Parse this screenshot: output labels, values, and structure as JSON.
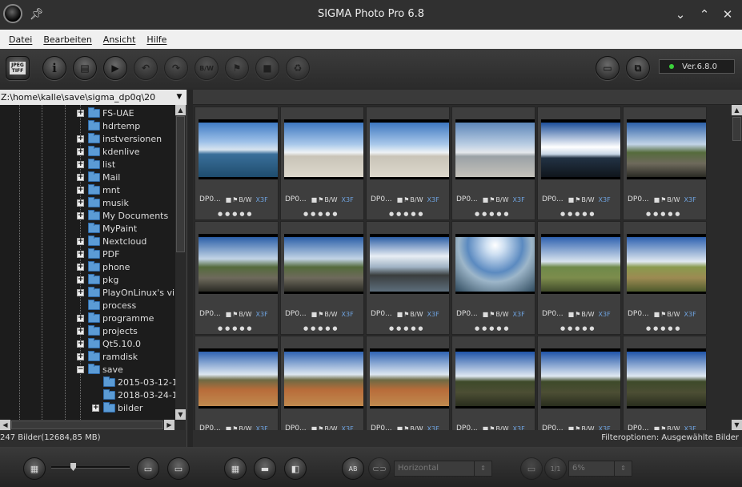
{
  "app": {
    "title": "SIGMA Photo Pro 6.8"
  },
  "window_controls": {
    "minimize": "⌄",
    "maximize": "⌃",
    "close": "✕"
  },
  "menu": [
    "Datei",
    "Bearbeiten",
    "Ansicht",
    "Hilfe"
  ],
  "toolbar": {
    "jpeg_tiff": "JPEG TIFF",
    "info": "i",
    "bw": "B/W",
    "version": "Ver.6.8.0"
  },
  "path": "Z:\\home\\kalle\\save\\sigma_dp0q\\20",
  "tree": [
    {
      "label": "FS-UAE",
      "expandable": true,
      "level": 1
    },
    {
      "label": "hdrtemp",
      "expandable": false,
      "level": 1
    },
    {
      "label": "instversionen",
      "expandable": true,
      "level": 1
    },
    {
      "label": "kdenlive",
      "expandable": true,
      "level": 1
    },
    {
      "label": "list",
      "expandable": true,
      "level": 1
    },
    {
      "label": "Mail",
      "expandable": true,
      "level": 1
    },
    {
      "label": "mnt",
      "expandable": true,
      "level": 1
    },
    {
      "label": "musik",
      "expandable": true,
      "level": 1
    },
    {
      "label": "My Documents",
      "expandable": true,
      "level": 1
    },
    {
      "label": "MyPaint",
      "expandable": false,
      "level": 1
    },
    {
      "label": "Nextcloud",
      "expandable": true,
      "level": 1
    },
    {
      "label": "PDF",
      "expandable": true,
      "level": 1
    },
    {
      "label": "phone",
      "expandable": true,
      "level": 1
    },
    {
      "label": "pkg",
      "expandable": true,
      "level": 1
    },
    {
      "label": "PlayOnLinux's virt",
      "expandable": true,
      "level": 1
    },
    {
      "label": "process",
      "expandable": false,
      "level": 1
    },
    {
      "label": "programme",
      "expandable": true,
      "level": 1
    },
    {
      "label": "projects",
      "expandable": true,
      "level": 1
    },
    {
      "label": "Qt5.10.0",
      "expandable": true,
      "level": 1
    },
    {
      "label": "ramdisk",
      "expandable": true,
      "level": 1
    },
    {
      "label": "save",
      "expandable": true,
      "expanded": true,
      "level": 1
    },
    {
      "label": "2015-03-12-1",
      "expandable": false,
      "level": 2
    },
    {
      "label": "2018-03-24-1",
      "expandable": false,
      "level": 2
    },
    {
      "label": "bilder",
      "expandable": true,
      "level": 2
    }
  ],
  "status_left": "247 Bilder(12684,85 MB)",
  "status_right": "Filteroptionen:  Ausgewählte Bilder",
  "thumbnails": [
    {
      "name": "DP0...",
      "scene": "sea",
      "format": "X3F",
      "bw": "B/W"
    },
    {
      "name": "DP0...",
      "scene": "beach",
      "format": "X3F",
      "bw": "B/W"
    },
    {
      "name": "DP0...",
      "scene": "beach",
      "format": "X3F",
      "bw": "B/W"
    },
    {
      "name": "DP0...",
      "scene": "beach-grey",
      "format": "X3F",
      "bw": "B/W"
    },
    {
      "name": "DP0...",
      "scene": "clouds-dark",
      "format": "X3F",
      "bw": "B/W"
    },
    {
      "name": "DP0...",
      "scene": "boardwalk",
      "format": "X3F",
      "bw": "B/W"
    },
    {
      "name": "DP0...",
      "scene": "boardwalk",
      "format": "X3F",
      "bw": "B/W"
    },
    {
      "name": "DP0...",
      "scene": "boardwalk",
      "format": "X3F",
      "bw": "B/W"
    },
    {
      "name": "DP0...",
      "scene": "pier",
      "format": "X3F",
      "bw": "B/W"
    },
    {
      "name": "DP0...",
      "scene": "sun",
      "format": "X3F",
      "bw": "B/W"
    },
    {
      "name": "DP0...",
      "scene": "meadow",
      "format": "X3F",
      "bw": "B/W"
    },
    {
      "name": "DP0...",
      "scene": "meadow-path",
      "format": "X3F",
      "bw": "B/W"
    },
    {
      "name": "DP0...",
      "scene": "field",
      "format": "X3F",
      "bw": "B/W"
    },
    {
      "name": "DP0...",
      "scene": "field",
      "format": "X3F",
      "bw": "B/W"
    },
    {
      "name": "DP0...",
      "scene": "field",
      "format": "X3F",
      "bw": "B/W"
    },
    {
      "name": "DP0...",
      "scene": "dunes",
      "format": "X3F",
      "bw": "B/W"
    },
    {
      "name": "DP0...",
      "scene": "dunes",
      "format": "X3F",
      "bw": "B/W"
    },
    {
      "name": "DP0...",
      "scene": "dunes",
      "format": "X3F",
      "bw": "B/W"
    }
  ],
  "bottom": {
    "orientation_combo": "Horizontal",
    "zoom_combo": "6%",
    "ab_label": "AB",
    "one_to_one": "1/1"
  },
  "colors": {
    "accent_green": "#3bd13b",
    "folder_blue": "#5b9bd5",
    "x3f_blue": "#6fa3e0"
  }
}
